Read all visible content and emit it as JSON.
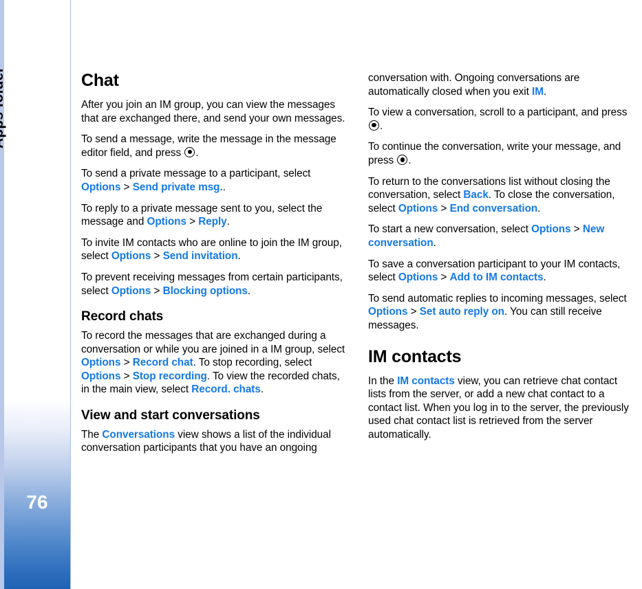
{
  "sidebar": {
    "tab_label": "Apps folder",
    "page_number": "76",
    "accent_color": "#2f6fbd",
    "edge_color": "#b9c8e8"
  },
  "theme": {
    "link_color": "#1479e4",
    "text_color": "#000000",
    "background": "#ffffff"
  },
  "left_column": {
    "heading": "Chat",
    "p1": "After you join an IM group, you can view the messages that are exchanged there, and send your own messages.",
    "p2_before": "To send a message, write the message in the message editor field, and press ",
    "p2_after": ".",
    "p3_before": "To send a private message to a participant, select ",
    "p3_ui1": "Options",
    "p3_sep": ">",
    "p3_ui2": "Send private msg.",
    "p3_after": ".",
    "p4_before": "To reply to a private message sent to you, select the message and ",
    "p4_ui1": "Options",
    "p4_sep": ">",
    "p4_ui2": "Reply",
    "p4_after": ".",
    "p5_before": "To invite IM contacts who are online to join the IM group, select ",
    "p5_ui1": "Options",
    "p5_sep": ">",
    "p5_ui2": "Send invitation",
    "p5_after": ".",
    "p6_before": "To prevent receiving messages from certain participants, select ",
    "p6_ui1": "Options",
    "p6_sep": ">",
    "p6_ui2": "Blocking options",
    "p6_after": ".",
    "subheading_record": "Record chats",
    "p7_before": "To record the messages that are exchanged during a conversation or while you are joined in a IM group, select ",
    "p7_ui1": "Options",
    "p7_sep1": ">",
    "p7_ui2": "Record chat",
    "p7_mid1": ". To stop recording, select ",
    "p7_ui3": "Options",
    "p7_sep2": ">",
    "p7_ui4": "Stop recording",
    "p7_mid2": ". To view the recorded chats, in the main view, select ",
    "p7_ui5": "Record. chats",
    "p7_after": ".",
    "subheading_view": "View and start conversations",
    "p8_before": "The ",
    "p8_ui1": "Conversations",
    "p8_after": " view shows a list of the individual conversation participants that you have an ongoing"
  },
  "right_column": {
    "p1_before": "conversation with. Ongoing conversations are automatically closed when you exit ",
    "p1_ui1": "IM",
    "p1_after": ".",
    "p2_before": "To view a conversation, scroll to a participant, and press ",
    "p2_after": ".",
    "p3_before": "To continue the conversation, write your message, and press ",
    "p3_after": ".",
    "p4_before": "To return to the conversations list without closing the conversation, select ",
    "p4_ui1": "Back",
    "p4_mid": ". To close the conversation, select ",
    "p4_ui2": "Options",
    "p4_sep": ">",
    "p4_ui3": "End conversation",
    "p4_after": ".",
    "p5_before": "To start a new conversation, select ",
    "p5_ui1": "Options",
    "p5_sep": ">",
    "p5_ui2": "New conversation",
    "p5_after": ".",
    "p6_before": "To save a conversation participant to your IM contacts, select ",
    "p6_ui1": "Options",
    "p6_sep": ">",
    "p6_ui2": "Add to IM contacts",
    "p6_after": ".",
    "p7_before": "To send automatic replies to incoming messages, select ",
    "p7_ui1": "Options",
    "p7_sep": ">",
    "p7_ui2": "Set auto reply on",
    "p7_after": ". You can still receive messages.",
    "heading_im": "IM contacts",
    "p8_before": "In the ",
    "p8_ui1": "IM contacts",
    "p8_after": " view, you can retrieve chat contact lists from the server, or add a new chat contact to a contact list. When you log in to the server, the previously used chat contact list is retrieved from the server automatically."
  }
}
